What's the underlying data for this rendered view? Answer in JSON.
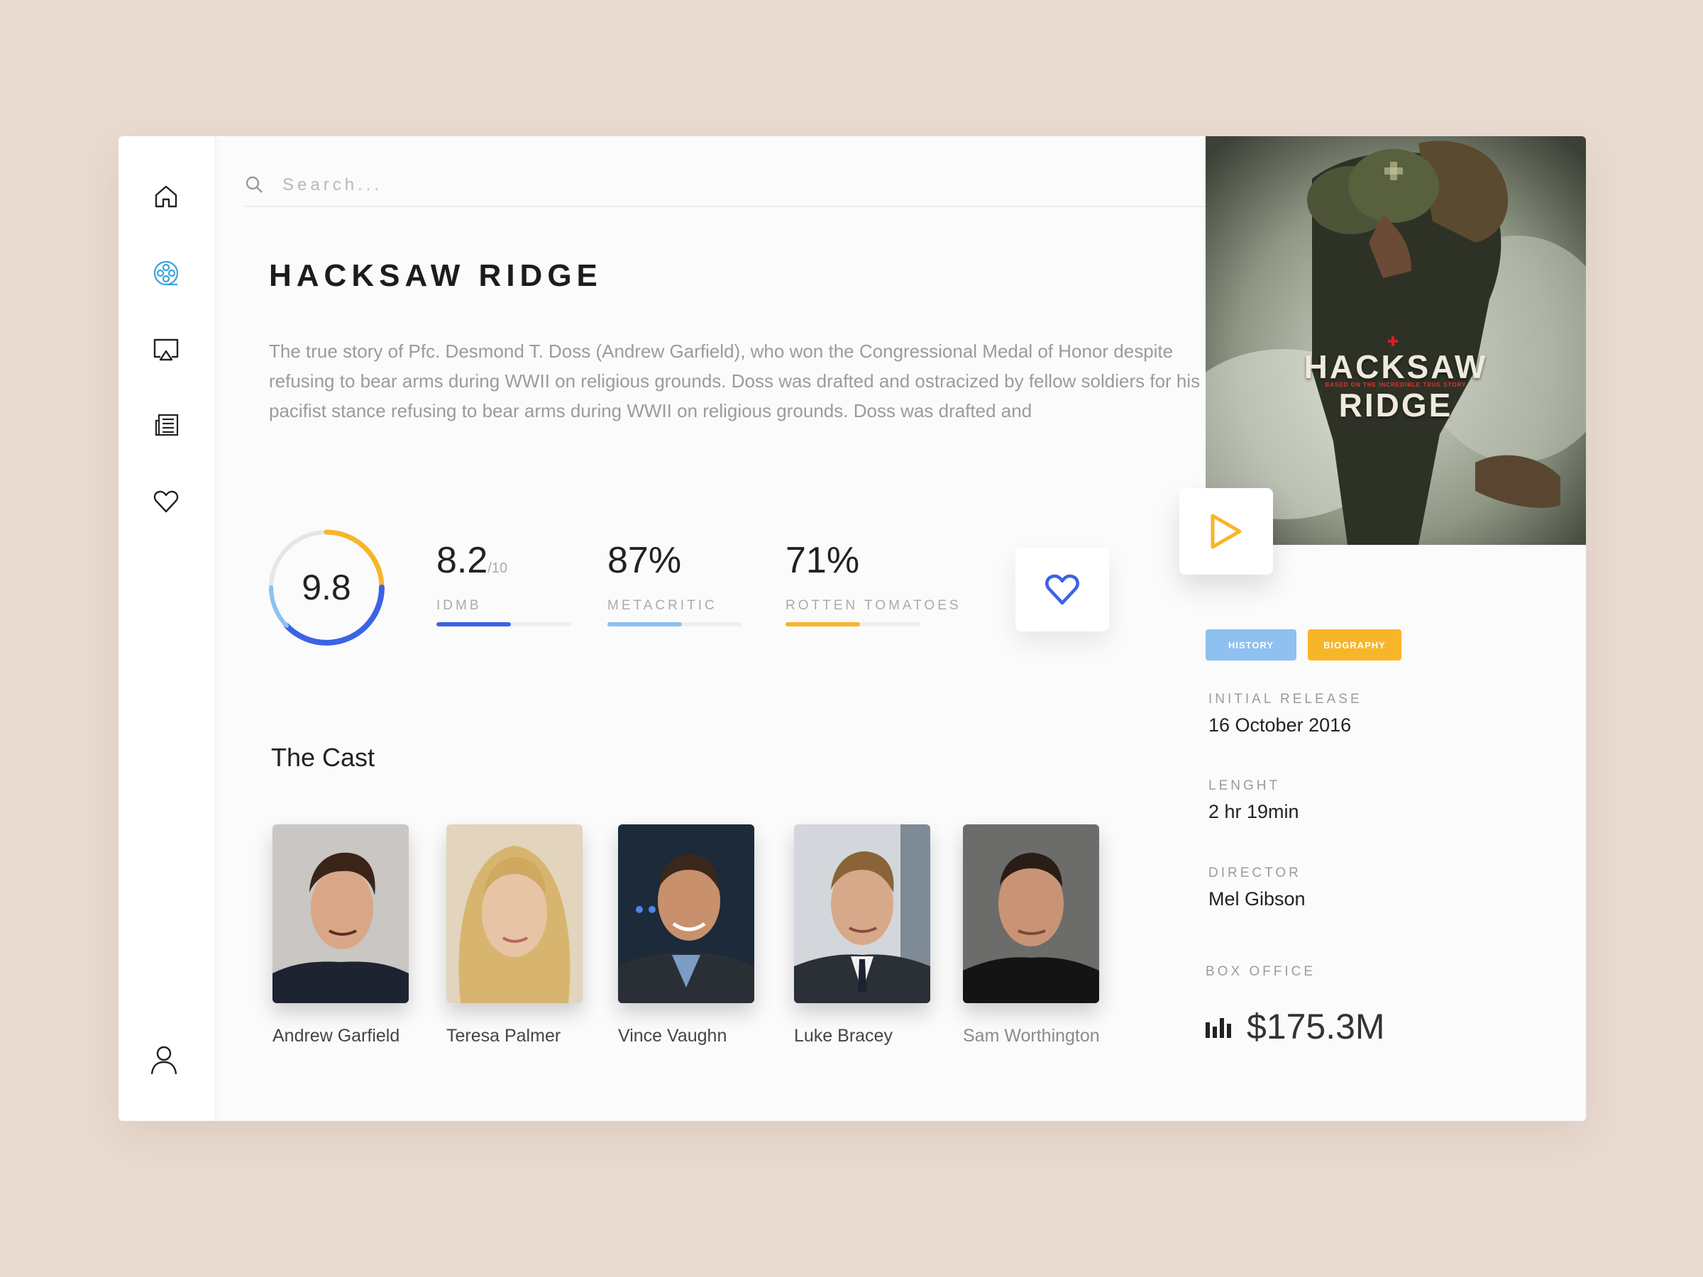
{
  "search": {
    "placeholder": "Search..."
  },
  "movie": {
    "title": "HACKSAW RIDGE",
    "description": "The true story of Pfc. Desmond T. Doss (Andrew Garfield), who won the Congressional Medal of Honor despite refusing to bear arms during WWII on religious grounds. Doss was drafted and ostracized by fellow soldiers for his pacifist stance  refusing to bear arms during WWII on religious grounds. Doss was drafted and",
    "overall_score": "9.8",
    "overall_score_fraction": 0.98
  },
  "ratings": [
    {
      "value": "8.2",
      "suffix": "/10",
      "label": "IDMB",
      "fraction": 0.55,
      "color": "#3b63e6"
    },
    {
      "value": "87%",
      "suffix": "",
      "label": "METACRITIC",
      "fraction": 0.55,
      "color": "#8ec0f0"
    },
    {
      "value": "71%",
      "suffix": "",
      "label": "ROTTEN TOMATOES",
      "fraction": 0.55,
      "color": "#f7b52a"
    }
  ],
  "cast": {
    "title": "The Cast",
    "members": [
      {
        "name": "Andrew Garfield"
      },
      {
        "name": "Teresa Palmer"
      },
      {
        "name": "Vince Vaughn"
      },
      {
        "name": "Luke Bracey"
      },
      {
        "name": "Sam Worthington"
      }
    ]
  },
  "poster": {
    "title_line1": "HACKSAW",
    "title_line2": "RIDGE",
    "tagline": "BASED ON THE INCREDIBLE TRUE STORY"
  },
  "genres": [
    {
      "label": "HISTORY",
      "color": "#8ec0f0"
    },
    {
      "label": "BIOGRAPHY",
      "color": "#f7b52a"
    }
  ],
  "details": {
    "release_label": "INITIAL RELEASE",
    "release_value": "16 October 2016",
    "length_label": "LENGHT",
    "length_value": "2 hr 19min",
    "director_label": "DIRECTOR",
    "director_value": "Mel Gibson",
    "box_office_label": "BOX OFFICE",
    "box_office_value": "$175.3M"
  },
  "colors": {
    "accent_blue": "#3b63e6",
    "accent_orange": "#f7b52a",
    "light_blue": "#8ec0f0",
    "nav_active": "#3aa4d8"
  },
  "icons": [
    "home-icon",
    "film-reel-icon",
    "airplay-icon",
    "news-icon",
    "heart-icon",
    "user-icon",
    "search-icon",
    "play-icon",
    "bar-chart-icon"
  ]
}
